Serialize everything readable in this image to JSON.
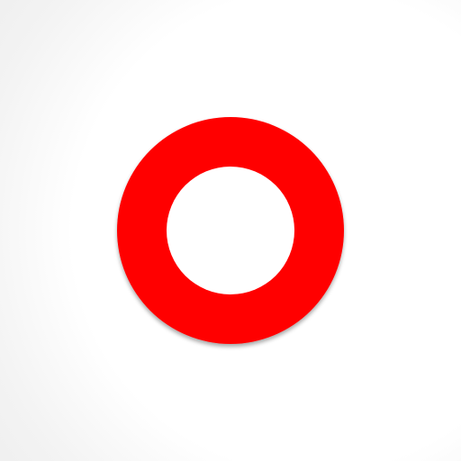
{
  "icon": {
    "name": "red-ring-icon",
    "ring_color": "#ff0000",
    "center_color": "#ffffff",
    "background_color": "#ffffff"
  }
}
